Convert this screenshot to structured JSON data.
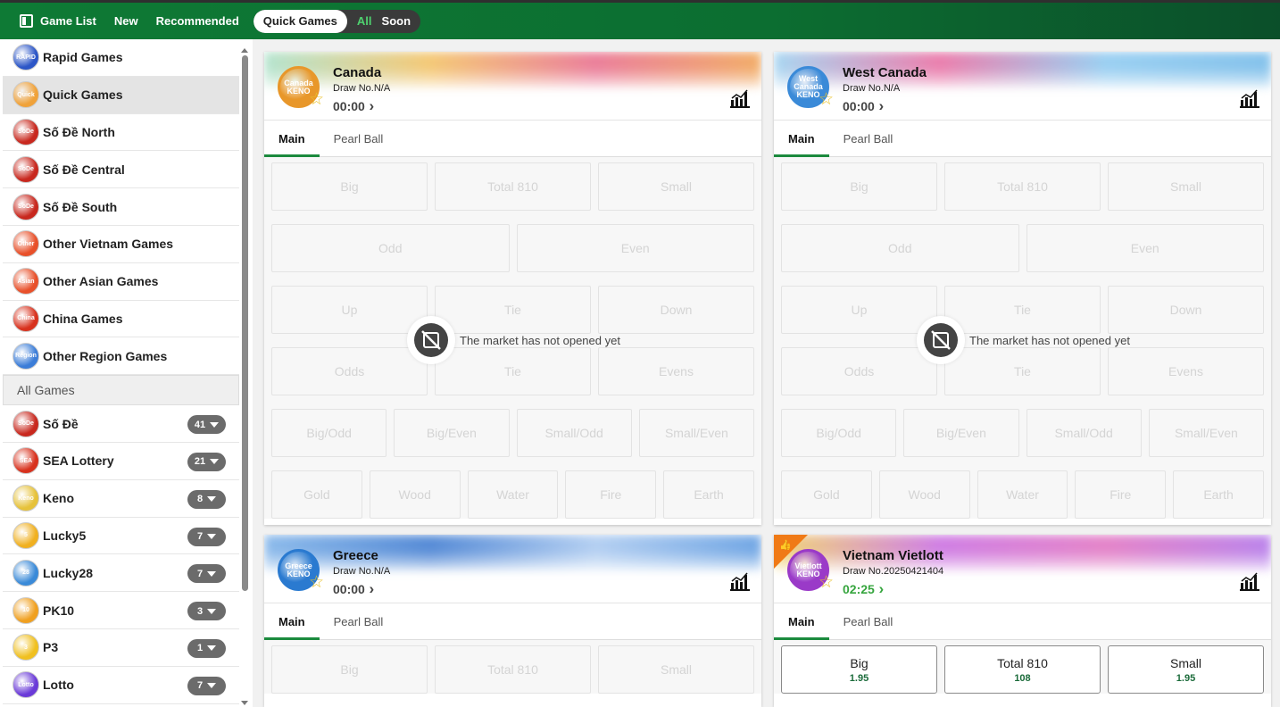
{
  "topbar": {
    "game_list": "Game List",
    "new": "New",
    "recommended": "Recommended",
    "quick_games": "Quick Games",
    "all": "All",
    "soon": "Soon"
  },
  "sidebar": {
    "categories": [
      {
        "label": "Rapid Games",
        "icon": "rapid-games-icon",
        "icon_text": "RAPID",
        "color": "#2c56c7"
      },
      {
        "label": "Quick Games",
        "icon": "quick-games-icon",
        "icon_text": "Quick",
        "color": "#f0a23a"
      },
      {
        "label": "Số Đề North",
        "icon": "so-de-north-icon",
        "icon_text": "SoDe",
        "color": "#c8281e"
      },
      {
        "label": "Số Đề Central",
        "icon": "so-de-central-icon",
        "icon_text": "SoDe",
        "color": "#c8281e"
      },
      {
        "label": "Số Đề South",
        "icon": "so-de-south-icon",
        "icon_text": "SoDe",
        "color": "#c8281e"
      },
      {
        "label": "Other Vietnam Games",
        "icon": "other-vietnam-games-icon",
        "icon_text": "Other",
        "color": "#e8502a"
      },
      {
        "label": "Other Asian Games",
        "icon": "other-asian-games-icon",
        "icon_text": "Asian",
        "color": "#e8502a"
      },
      {
        "label": "China Games",
        "icon": "china-games-icon",
        "icon_text": "China",
        "color": "#d8321e"
      },
      {
        "label": "Other Region Games",
        "icon": "other-region-games-icon",
        "icon_text": "Region",
        "color": "#3b7dd8"
      }
    ],
    "all_games_header": "All Games",
    "games": [
      {
        "label": "Số Đề",
        "count": "41",
        "icon": "so-de-icon",
        "icon_text": "SoDe",
        "color": "#c8281e"
      },
      {
        "label": "SEA Lottery",
        "count": "21",
        "icon": "sea-lottery-icon",
        "icon_text": "SEA",
        "color": "#d8321e"
      },
      {
        "label": "Keno",
        "count": "8",
        "icon": "keno-icon",
        "icon_text": "Keno",
        "color": "#e6c23a"
      },
      {
        "label": "Lucky5",
        "count": "7",
        "icon": "lucky5-icon",
        "icon_text": "5",
        "color": "#f0b020"
      },
      {
        "label": "Lucky28",
        "count": "7",
        "icon": "lucky28-icon",
        "icon_text": "28",
        "color": "#3a8ad8"
      },
      {
        "label": "PK10",
        "count": "3",
        "icon": "pk10-icon",
        "icon_text": "10",
        "color": "#f0a020"
      },
      {
        "label": "P3",
        "count": "1",
        "icon": "p3-icon",
        "icon_text": "3",
        "color": "#f0c020"
      },
      {
        "label": "Lotto",
        "count": "7",
        "icon": "lotto-icon",
        "icon_text": "Lotto",
        "color": "#6a3ad8"
      }
    ]
  },
  "cards": [
    {
      "title": "Canada",
      "draw": "Draw No.N/A",
      "time": "00:00",
      "logo_text": "Canada KENO",
      "logo_color": "#e8972a",
      "banner": [
        "#a8e0c8",
        "#f3c060",
        "#e86a8a",
        "#f0a050"
      ],
      "tabs": [
        "Main",
        "Pearl Ball"
      ],
      "closed_message": "The market has not opened yet",
      "rows": [
        [
          "Big",
          "Total 810",
          "Small"
        ],
        [
          "Odd",
          "Even"
        ],
        [
          "Up",
          "Tie",
          "Down"
        ],
        [
          "Odds",
          "Tie",
          "Evens"
        ],
        [
          "Big/Odd",
          "Big/Even",
          "Small/Odd",
          "Small/Even"
        ],
        [
          "Gold",
          "Wood",
          "Water",
          "Fire",
          "Earth"
        ]
      ]
    },
    {
      "title": "West Canada",
      "draw": "Draw No.N/A",
      "time": "00:00",
      "logo_text": "West Canada KENO",
      "logo_color": "#3a8ad8",
      "banner": [
        "#9ad0f0",
        "#e86aa0",
        "#8ac8f0",
        "#70b8e8"
      ],
      "tabs": [
        "Main",
        "Pearl Ball"
      ],
      "closed_message": "The market has not opened yet",
      "rows": [
        [
          "Big",
          "Total 810",
          "Small"
        ],
        [
          "Odd",
          "Even"
        ],
        [
          "Up",
          "Tie",
          "Down"
        ],
        [
          "Odds",
          "Tie",
          "Evens"
        ],
        [
          "Big/Odd",
          "Big/Even",
          "Small/Odd",
          "Small/Even"
        ],
        [
          "Gold",
          "Wood",
          "Water",
          "Fire",
          "Earth"
        ]
      ]
    },
    {
      "title": "Greece",
      "draw": "Draw No.N/A",
      "time": "00:00",
      "logo_text": "Greece KENO",
      "logo_color": "#2a7ad0",
      "banner": [
        "#7ab0e8",
        "#3a78d0",
        "#a8c8f0",
        "#5a98e0"
      ],
      "tabs": [
        "Main",
        "Pearl Ball"
      ],
      "rows": [
        [
          "Big",
          "Total 810",
          "Small"
        ]
      ]
    },
    {
      "title": "Vietnam Vietlott",
      "draw": "Draw No.20250421404",
      "time": "02:25",
      "logo_text": "Vietlott KENO",
      "logo_color": "#9a3ac8",
      "banner": [
        "#f0d060",
        "#c86ae0",
        "#e070c0",
        "#b070e8"
      ],
      "tabs": [
        "Main",
        "Pearl Ball"
      ],
      "rows": [
        [
          {
            "label": "Big",
            "odds": "1.95"
          },
          {
            "label": "Total 810",
            "odds": "108"
          },
          {
            "label": "Small",
            "odds": "1.95"
          }
        ]
      ]
    }
  ],
  "colors": {
    "topbar": "#0e7a35",
    "active_tab": "#1b8a3d",
    "star": "#e9c22c",
    "live_time": "#36a53e",
    "odds": "#1b6b3a",
    "ribbon": "#f07a16"
  }
}
